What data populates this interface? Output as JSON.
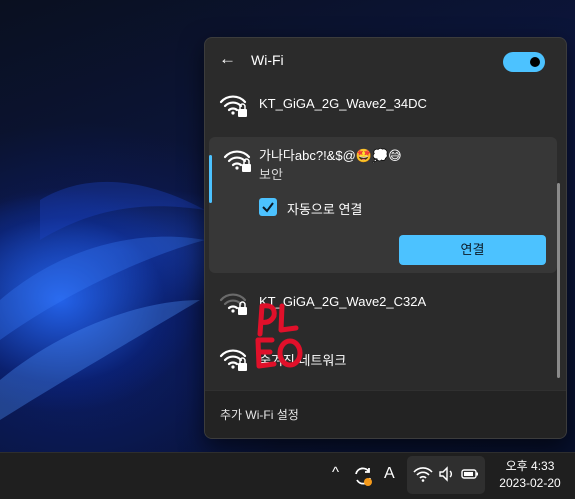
{
  "panel": {
    "title": "Wi-Fi",
    "back_icon": "back-arrow-icon",
    "wifi_toggle": "on",
    "accent_color": "#4cc2ff",
    "networks": [
      {
        "name": "KT_GiGA_2G_Wave2_34DC",
        "icon": "wifi-secured-icon",
        "signal": "full"
      },
      {
        "name": "KT_GiGA_2G_Wave2_C32A",
        "icon": "wifi-secured-icon",
        "signal": "weak"
      },
      {
        "name": "숨겨진 네트워크",
        "icon": "wifi-secured-icon",
        "signal": "full"
      }
    ],
    "selected": {
      "name": "가나다abc?!&$@🤩💭😅",
      "security": "보안",
      "auto_connect_label": "자동으로 연결",
      "auto_connect_checked": true,
      "connect_label": "연결"
    },
    "footer_link": "추가 Wi-Fi 설정"
  },
  "taskbar": {
    "ime_indicator": "A",
    "time": "오후 4:33",
    "date": "2023-02-20",
    "icons": [
      "chevron-up-icon",
      "sync-icon",
      "wifi-icon",
      "volume-icon",
      "battery-icon"
    ]
  },
  "overlay_text": "PLEO"
}
